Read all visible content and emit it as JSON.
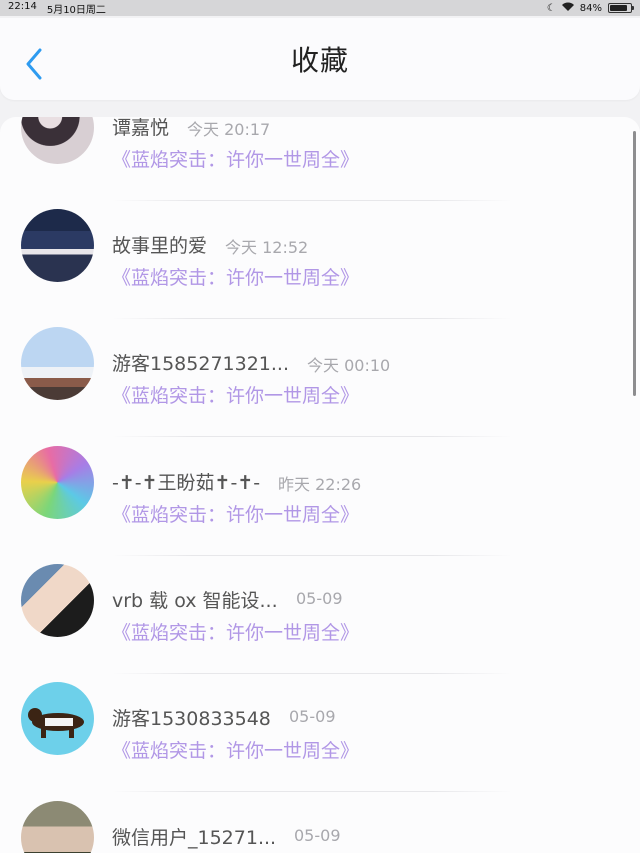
{
  "status_bar": {
    "time": "22:14",
    "date": "5月10日周二",
    "battery": "84%",
    "battery_level": 0.84
  },
  "header": {
    "title": "收藏",
    "back_icon": "chevron-left-icon",
    "accent": "#2e9bf0"
  },
  "favorites": [
    {
      "name": "谭嘉悦",
      "time": "今天 20:17",
      "work": "《蓝焰突击：许你一世周全》",
      "avatar_icon": "avatar-photo"
    },
    {
      "name": "故事里的爱",
      "time": "今天 12:52",
      "work": "《蓝焰突击：许你一世周全》",
      "avatar_icon": "avatar-photo"
    },
    {
      "name": "游客1585271321...",
      "time": "今天 00:10",
      "work": "《蓝焰突击：许你一世周全》",
      "avatar_icon": "avatar-statue"
    },
    {
      "name": "-✝-✝王盼茹✝-✝-",
      "time": "昨天 22:26",
      "work": "《蓝焰突击：许你一世周全》",
      "avatar_icon": "avatar-anime"
    },
    {
      "name": "vrb 载 ox 智能设...",
      "time": "05-09",
      "work": "《蓝焰突击：许你一世周全》",
      "avatar_icon": "avatar-photo"
    },
    {
      "name": "游客1530833548",
      "time": "05-09",
      "work": "《蓝焰突击：许你一世周全》",
      "avatar_icon": "avatar-dog-cartoon"
    },
    {
      "name": "微信用户_15271...",
      "time": "05-09",
      "work": "",
      "avatar_icon": "avatar-photo"
    }
  ],
  "colors": {
    "work_title": "#b197e6",
    "name": "#555555",
    "time": "#a8a8ad"
  }
}
